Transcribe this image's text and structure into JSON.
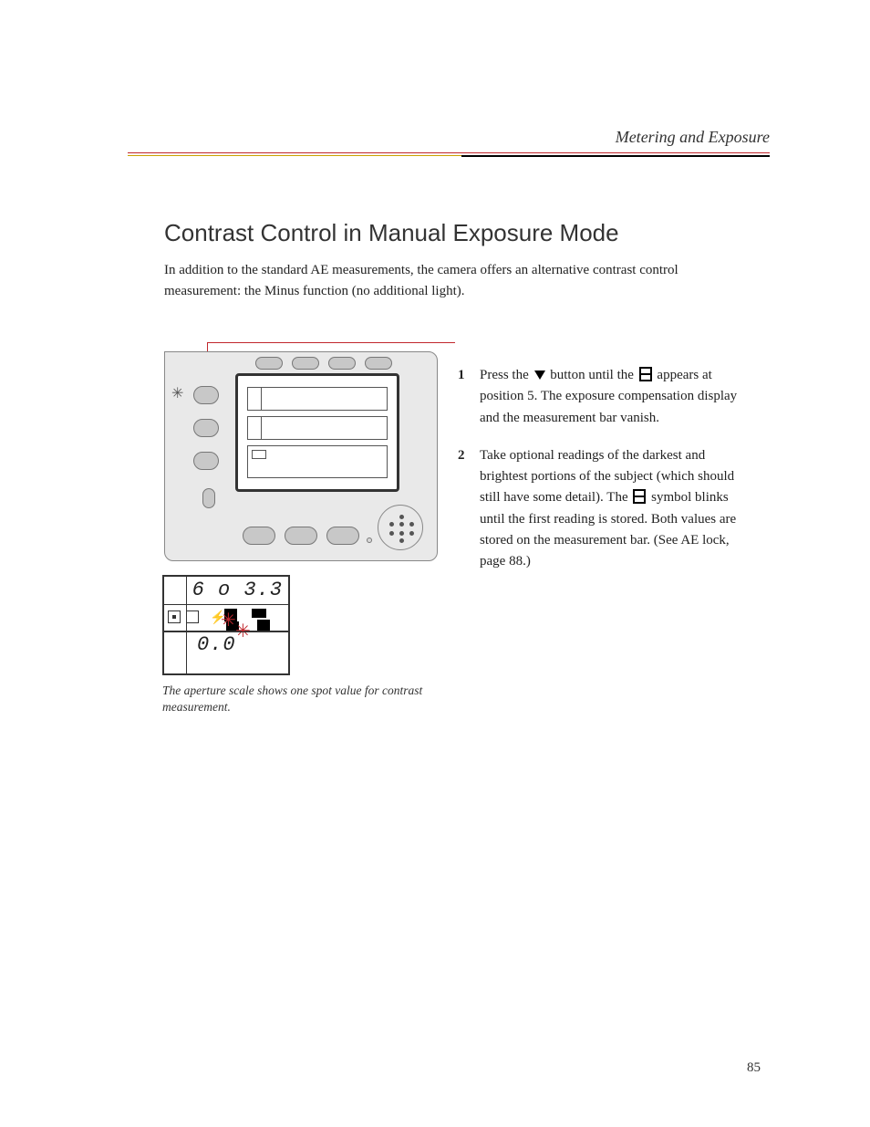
{
  "header": {
    "title": "Metering and Exposure"
  },
  "section": {
    "title": "Contrast Control in Manual Exposure Mode",
    "intro": "In addition to the standard AE measurements, the camera offers an alternative contrast control measurement: the Minus function (no additional light)."
  },
  "steps": [
    {
      "num": "1",
      "pre": "Press the ",
      "mid": " button until the ",
      "icon": "minus-bracket",
      "post": " appears at position 5. The exposure compensation display and the measurement bar vanish."
    },
    {
      "num": "2",
      "pre": "Take optional readings of the darkest and brightest portions of the subject (which should still have some detail). The ",
      "icon": "minus-bracket",
      "post": " symbol blinks until the first reading is stored. Both values are stored on the measurement bar. (See AE lock, page 88.)"
    }
  ],
  "captions": {
    "caption1": "The aperture scale shows one spot value for contrast measurement."
  },
  "detail": {
    "top_right": "6 o  3.3",
    "bottom": "0.0"
  },
  "page_number": "85"
}
